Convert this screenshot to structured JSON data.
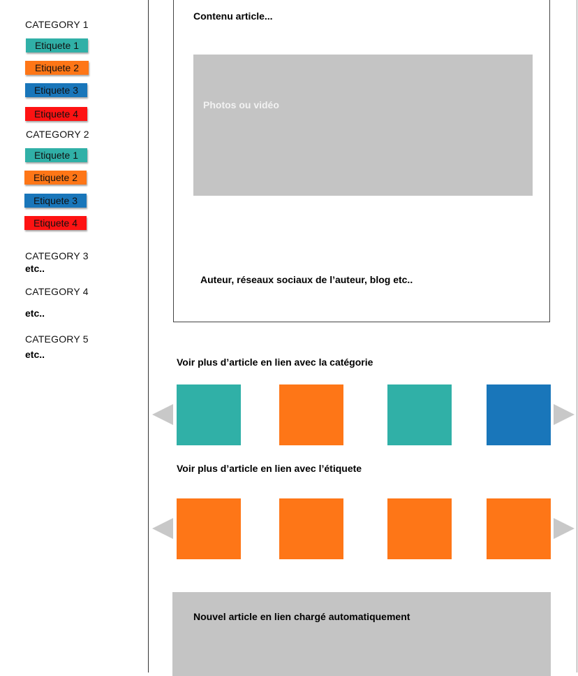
{
  "colors": {
    "teal": "#30b0a7",
    "orange": "#fe7617",
    "blue": "#1976ba",
    "red": "#fe1313",
    "gray": "#c4c4c4"
  },
  "sidebar": {
    "category1": {
      "title": "CATEGORY 1",
      "tags": [
        "Etiquete 1",
        "Etiquete 2",
        "Etiquete 3",
        "Etiquete 4"
      ]
    },
    "category2": {
      "title": "CATEGORY 2",
      "tags": [
        "Etiquete 1",
        "Etiquete 2",
        "Etiquete 3",
        "Etiquete 4"
      ]
    },
    "category3": {
      "title": "CATEGORY 3",
      "etc": "etc.."
    },
    "category4": {
      "title": "CATEGORY 4",
      "etc": "etc.."
    },
    "category5": {
      "title": "CATEGORY 5",
      "etc": "etc.."
    }
  },
  "article": {
    "content_label": "Contenu article...",
    "media_label": "Photos ou vidéo",
    "author_label": "Auteur,  réseaux sociaux de l’auteur, blog etc.."
  },
  "related_category": {
    "heading": "Voir plus d’article en lien avec la catégorie",
    "thumbs": [
      "teal",
      "orange",
      "teal",
      "blue"
    ]
  },
  "related_tag": {
    "heading": "Voir plus d’article en lien avec l’étiquete",
    "thumbs": [
      "orange",
      "orange",
      "orange",
      "orange"
    ]
  },
  "next_article": {
    "label": "Nouvel article en lien chargé automatiquement"
  }
}
